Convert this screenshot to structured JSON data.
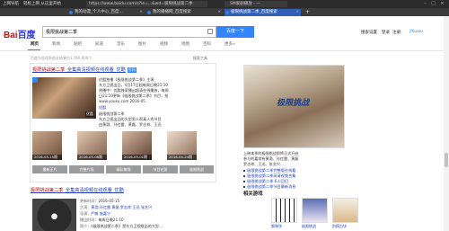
{
  "browser": {
    "nav": [
      "上网导航",
      "轻松上网 从这里开始"
    ],
    "url": "https://www.baidu.com/s?ie=...&wd=极限挑战第二季",
    "url_tab": "SM爱剧播放 - 一",
    "tabs": [
      {
        "label": "我的动漫_个人中心_百度..."
      },
      {
        "label": "我的播播网_百度搜索"
      },
      {
        "label": "极限挑战第二季_百度搜索"
      }
    ],
    "new_tab": "+"
  },
  "header": {
    "logo_text": "Bai",
    "logo_paw": "百度",
    "search_value": "极限挑战第二季",
    "search_button": "百度一下",
    "links": [
      "搜索设置",
      "登录",
      "注册",
      "jfkuxiu"
    ]
  },
  "nav_tabs": [
    "网页",
    "新闻",
    "贴吧",
    "知道",
    "音乐",
    "图片",
    "视频",
    "地图",
    "百科",
    "更多»"
  ],
  "result_count": "百度为您找到相关结果约1,760,000个",
  "tools": "搜索工具",
  "result1": {
    "title_hl": "极限挑战第二季",
    "title_rest": "_全集高清视频在线观看_优酷",
    "tag": "官网",
    "thumb_caption": "优酷",
    "desc": [
      "优酷独播《极限挑战第二季》主演",
      "东方卫视出品，4月17日起每周日晚21:10",
      "热播中！优酷独家播出超清在线播放，每周",
      "日21:10更新《极限挑战第二季》节目，抢",
      "先看"
    ],
    "site": "www.youku.com 2016-05",
    "source": "优酷",
    "desc2": [
      "极限挑战第二季",
      "东方卫视出品的大型男人帮真人秀节目",
      "由黄渤、孙红雷、黄磊、罗志祥、王迅",
      "等明星组成..."
    ],
    "shots": [
      {
        "date": "2016-05-15期"
      },
      {
        "date": "2016-05-08期"
      },
      {
        "date": "2016-05-01期"
      },
      {
        "date": "2016-04-24期"
      }
    ],
    "episode_buttons": [
      "最新正片",
      "完整片段",
      "精彩集锦",
      "节目花絮",
      "极限挑战"
    ]
  },
  "result2": {
    "title_hl": "极限挑战第二季",
    "title_rest": "_全集高清视频在线观看_优酷",
    "lines": [
      {
        "label": "更新时间：",
        "value": "2016-05-15"
      },
      {
        "label": "主演：",
        "value": "黄渤 孙红雷 黄磊 罗志祥 王迅 张艺兴"
      },
      {
        "label": "导演：",
        "value": "严敏 施嘉宁"
      },
      {
        "label": "播出时间：",
        "value": "每周日晚21:10"
      },
      {
        "label": "简介：",
        "value": "《极限挑战第二季》是东方卫视推出的大型..."
      }
    ]
  },
  "right": {
    "poster_logo": "极限挑战",
    "desc": [
      "上映本季的极限挑战即将正式开启",
      "参与的嘉宾有黄渤、孙红雷、黄磊",
      "罗志祥、王迅、张艺兴..."
    ],
    "links": [
      "极限挑战第二季完整版在线看",
      "极限挑战第二季高清视频合集",
      "极限挑战第二季 6人回归",
      "极限挑战第二季节目最新消息"
    ],
    "related_title": "相关游戏",
    "related": [
      {
        "caption": "钢琴块"
      },
      {
        "caption": "极限挑战"
      },
      {
        "caption": "别踩白块"
      }
    ]
  }
}
